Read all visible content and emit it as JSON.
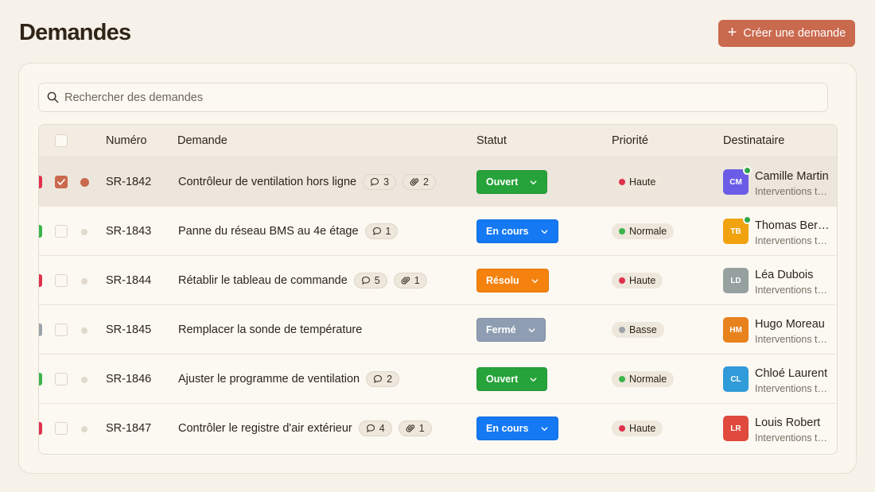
{
  "page": {
    "title": "Demandes"
  },
  "header": {
    "create_label": "Créer une demande"
  },
  "search": {
    "placeholder": "Rechercher des demandes"
  },
  "columns": {
    "number": "Numéro",
    "request": "Demande",
    "status": "Statut",
    "priority": "Priorité",
    "assignee": "Destinataire"
  },
  "colors": {
    "accent": "#c9694e",
    "status": {
      "Ouvert": "#27a33b",
      "En cours": "#1479f3",
      "Résolu": "#f5820e",
      "Fermé": "#8e9db2"
    },
    "priority": {
      "Haute": "#e0314b",
      "Normale": "#3bb54a",
      "Basse": "#9ca3ab"
    }
  },
  "rows": [
    {
      "number": "SR-1842",
      "title": "Contrôleur de ventilation hors ligne",
      "comments": "3",
      "attachments": "2",
      "status": "Ouvert",
      "priority": "Haute",
      "initials": "CM",
      "avatar_color": "#6b5ce7",
      "online": true,
      "assignee": "Camille Martin",
      "team": "Interventions techniques",
      "selected": true
    },
    {
      "number": "SR-1843",
      "title": "Panne du réseau BMS au 4e étage",
      "comments": "1",
      "attachments": null,
      "status": "En cours",
      "priority": "Normale",
      "initials": "TB",
      "avatar_color": "#f0a20f",
      "online": true,
      "assignee": "Thomas Bernard",
      "team": "Interventions techniques",
      "selected": false
    },
    {
      "number": "SR-1844",
      "title": "Rétablir le tableau de commande",
      "comments": "5",
      "attachments": "1",
      "status": "Résolu",
      "priority": "Haute",
      "initials": "LD",
      "avatar_color": "#95a09f",
      "online": false,
      "assignee": "Léa Dubois",
      "team": "Interventions techniques",
      "selected": false
    },
    {
      "number": "SR-1845",
      "title": "Remplacer la sonde de température",
      "comments": null,
      "attachments": null,
      "status": "Fermé",
      "priority": "Basse",
      "initials": "HM",
      "avatar_color": "#e8821d",
      "online": false,
      "assignee": "Hugo Moreau",
      "team": "Interventions techniques",
      "selected": false
    },
    {
      "number": "SR-1846",
      "title": "Ajuster le programme de ventilation",
      "comments": "2",
      "attachments": null,
      "status": "Ouvert",
      "priority": "Normale",
      "initials": "CL",
      "avatar_color": "#2f9bd8",
      "online": false,
      "assignee": "Chloé Laurent",
      "team": "Interventions techniques",
      "selected": false
    },
    {
      "number": "SR-1847",
      "title": "Contrôler le registre d'air extérieur",
      "comments": "4",
      "attachments": "1",
      "status": "En cours",
      "priority": "Haute",
      "initials": "LR",
      "avatar_color": "#e04a3c",
      "online": false,
      "assignee": "Louis Robert",
      "team": "Interventions techniques",
      "selected": false
    }
  ]
}
